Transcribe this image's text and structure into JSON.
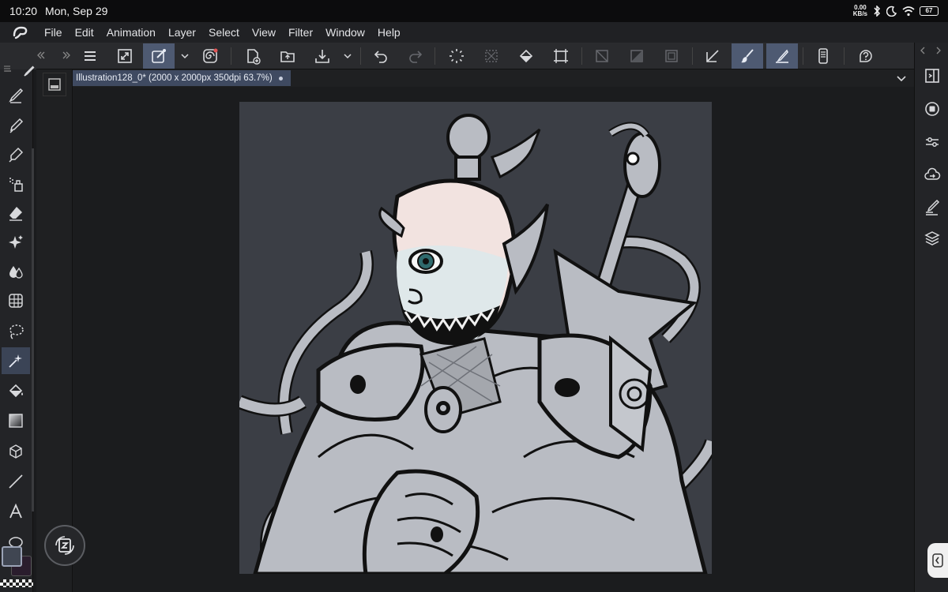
{
  "status": {
    "time": "10:20",
    "date": "Mon, Sep 29",
    "net_speed_value": "0.00",
    "net_speed_unit": "KB/s",
    "battery": "67"
  },
  "menu": {
    "items": [
      "File",
      "Edit",
      "Animation",
      "Layer",
      "Select",
      "View",
      "Filter",
      "Window",
      "Help"
    ]
  },
  "document": {
    "tab_title": "Illustration128_0* (2000 x 2000px 350dpi 63.7%)"
  },
  "icons": {
    "toolbar": [
      "menu-icon",
      "fit-screen-icon",
      "transform-icon",
      "chevron-down-icon",
      "spiral-icon",
      "new-canvas-icon",
      "open-folder-icon",
      "save-icon",
      "chevron-down-icon",
      "undo-icon",
      "redo-icon",
      "loading-icon",
      "deselect-icon",
      "fill-icon",
      "crop-icon",
      "ruler-off-icon",
      "mask-icon",
      "frame-icon",
      "snap-icon",
      "brush-icon",
      "pen-icon",
      "device-icon",
      "help-icon"
    ],
    "left_tools": [
      "pen-nib-icon",
      "pencil-icon",
      "marker-icon",
      "airbrush-icon",
      "eraser-icon",
      "sparkle-icon",
      "blend-icon",
      "grid-icon",
      "lasso-icon",
      "magic-wand-icon",
      "bucket-icon",
      "gradient-icon",
      "3d-cube-icon",
      "line-icon",
      "text-icon",
      "ellipse-icon"
    ],
    "right_panel": [
      "panel-toggle-icon",
      "record-icon",
      "sliders-icon",
      "cloud-sync-icon",
      "pen-settings-icon",
      "layers-icon"
    ]
  },
  "colors": {
    "accent": "#4e5a72",
    "main_color": "#404652",
    "sub_color": "#2a1d2d",
    "canvas_bg": "#3b3e45"
  }
}
